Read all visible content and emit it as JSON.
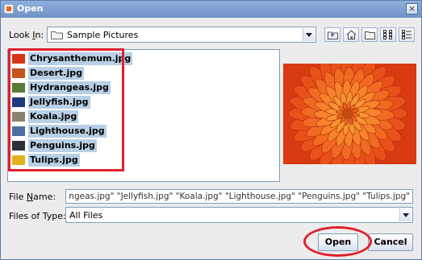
{
  "window": {
    "title": "Open",
    "close_glyph": "×"
  },
  "look_in": {
    "label_prefix": "Look ",
    "label_underlined": "I",
    "label_suffix": "n:",
    "value": "Sample Pictures",
    "icon": "folder-icon"
  },
  "toolbar": {
    "icons": [
      "up-one-level-icon",
      "home-icon",
      "new-folder-icon",
      "list-view-icon",
      "details-view-icon"
    ]
  },
  "files": [
    {
      "name": "Chrysanthemum.jpg",
      "thumb_color": "#d6361a"
    },
    {
      "name": "Desert.jpg",
      "thumb_color": "#c2541c"
    },
    {
      "name": "Hydrangeas.jpg",
      "thumb_color": "#5a7a3a"
    },
    {
      "name": "Jellyfish.jpg",
      "thumb_color": "#1d3b7a"
    },
    {
      "name": "Koala.jpg",
      "thumb_color": "#8a8275"
    },
    {
      "name": "Lighthouse.jpg",
      "thumb_color": "#4d6fa0"
    },
    {
      "name": "Penguins.jpg",
      "thumb_color": "#2a2f3a"
    },
    {
      "name": "Tulips.jpg",
      "thumb_color": "#e2b21c"
    }
  ],
  "file_name": {
    "label_prefix": "File ",
    "label_underlined": "N",
    "label_suffix": "ame:",
    "value": "\"Chrysanthemum.jpg\" \"Desert.jpg\" \"Hydrangeas.jpg\" \"Jellyfish.jpg\" \"Koala.jpg\" \"Lighthouse.jpg\" \"Penguins.jpg\" \"Tulips.jpg\""
  },
  "files_of_type": {
    "label": "Files of Type:",
    "value": "All Files"
  },
  "buttons": {
    "open": "Open",
    "cancel": "Cancel"
  },
  "colors": {
    "selection": "#b8cfe5",
    "annotation": "#e0202c",
    "title_bar": "#7a9acc"
  }
}
